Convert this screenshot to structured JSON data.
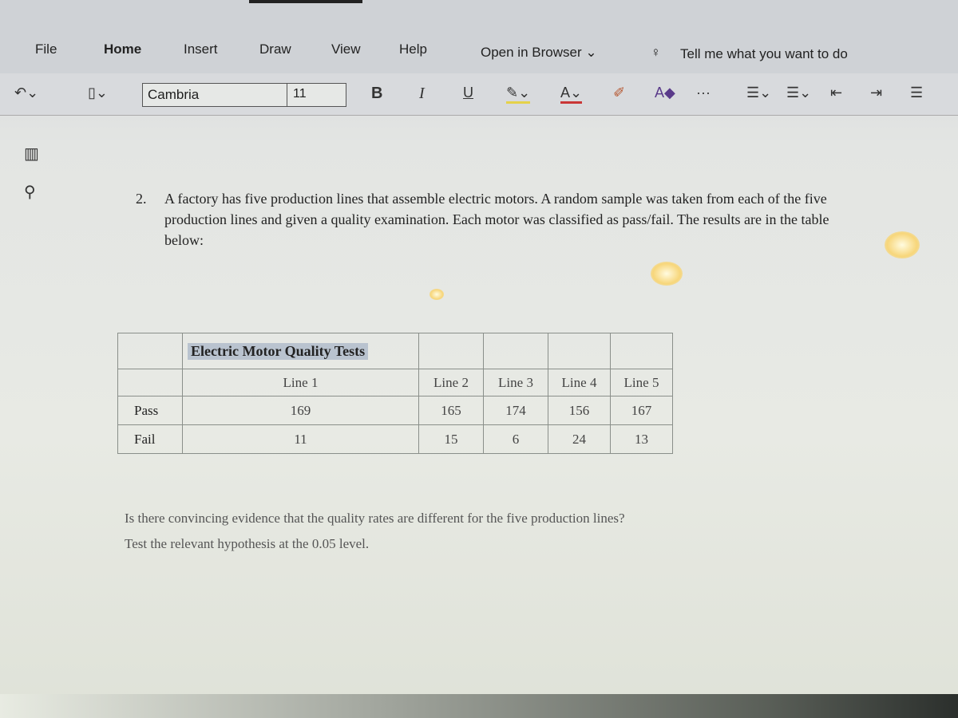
{
  "menu": [
    "File",
    "Home",
    "Insert",
    "Draw",
    "View",
    "Help"
  ],
  "open_in_browser": "Open in Browser ⌄",
  "tell_me": "Tell me what you want to do",
  "toolbar": {
    "font_name": "Cambria",
    "font_size": "11",
    "bold": "B",
    "italic": "I",
    "underline": "U",
    "more": "···"
  },
  "question": {
    "number": "2.",
    "text": "A factory has five production lines that assemble electric motors. A random sample was taken from each of the five production lines and given a quality examination. Each motor was classified as pass/fail. The results are in the table below:"
  },
  "table": {
    "caption": "Electric Motor Quality Tests",
    "columns": [
      "Line 1",
      "Line 2",
      "Line 3",
      "Line 4",
      "Line 5"
    ],
    "rows": [
      {
        "label": "Pass",
        "values": [
          "169",
          "165",
          "174",
          "156",
          "167"
        ]
      },
      {
        "label": "Fail",
        "values": [
          "11",
          "15",
          "6",
          "24",
          "13"
        ]
      }
    ]
  },
  "followup": {
    "line1": "Is there convincing evidence that the quality rates are different for the five production lines?",
    "line2": "Test the relevant hypothesis at the 0.05 level."
  }
}
